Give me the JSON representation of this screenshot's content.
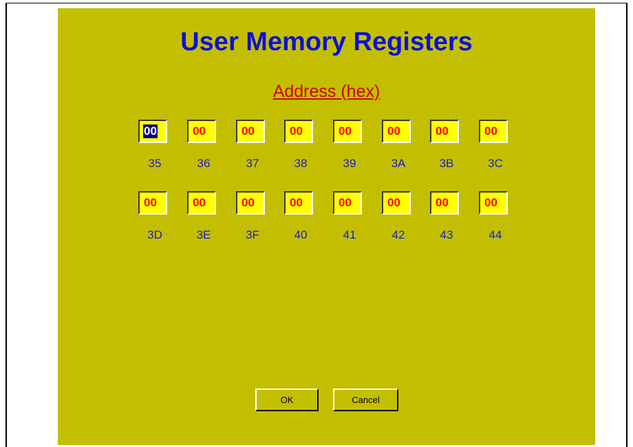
{
  "dialog": {
    "title": "User Memory Registers",
    "subtitle": "Address (hex)"
  },
  "registers": [
    {
      "address": "35",
      "value": "00",
      "selected": true
    },
    {
      "address": "36",
      "value": "00"
    },
    {
      "address": "37",
      "value": "00"
    },
    {
      "address": "38",
      "value": "00"
    },
    {
      "address": "39",
      "value": "00"
    },
    {
      "address": "3A",
      "value": "00"
    },
    {
      "address": "3B",
      "value": "00"
    },
    {
      "address": "3C",
      "value": "00"
    },
    {
      "address": "3D",
      "value": "00"
    },
    {
      "address": "3E",
      "value": "00"
    },
    {
      "address": "3F",
      "value": "00"
    },
    {
      "address": "40",
      "value": "00"
    },
    {
      "address": "41",
      "value": "00"
    },
    {
      "address": "42",
      "value": "00"
    },
    {
      "address": "43",
      "value": "00"
    },
    {
      "address": "44",
      "value": "00"
    }
  ],
  "buttons": {
    "ok_label": "OK",
    "cancel_label": "Cancel"
  },
  "colors": {
    "panel_background": "#c3bf00",
    "title": "#0d10d8",
    "subtitle": "#d40000",
    "register_field": "#ffff00",
    "register_value": "#ff0000",
    "address_label": "#1a1ac0",
    "selection": "#000080"
  }
}
